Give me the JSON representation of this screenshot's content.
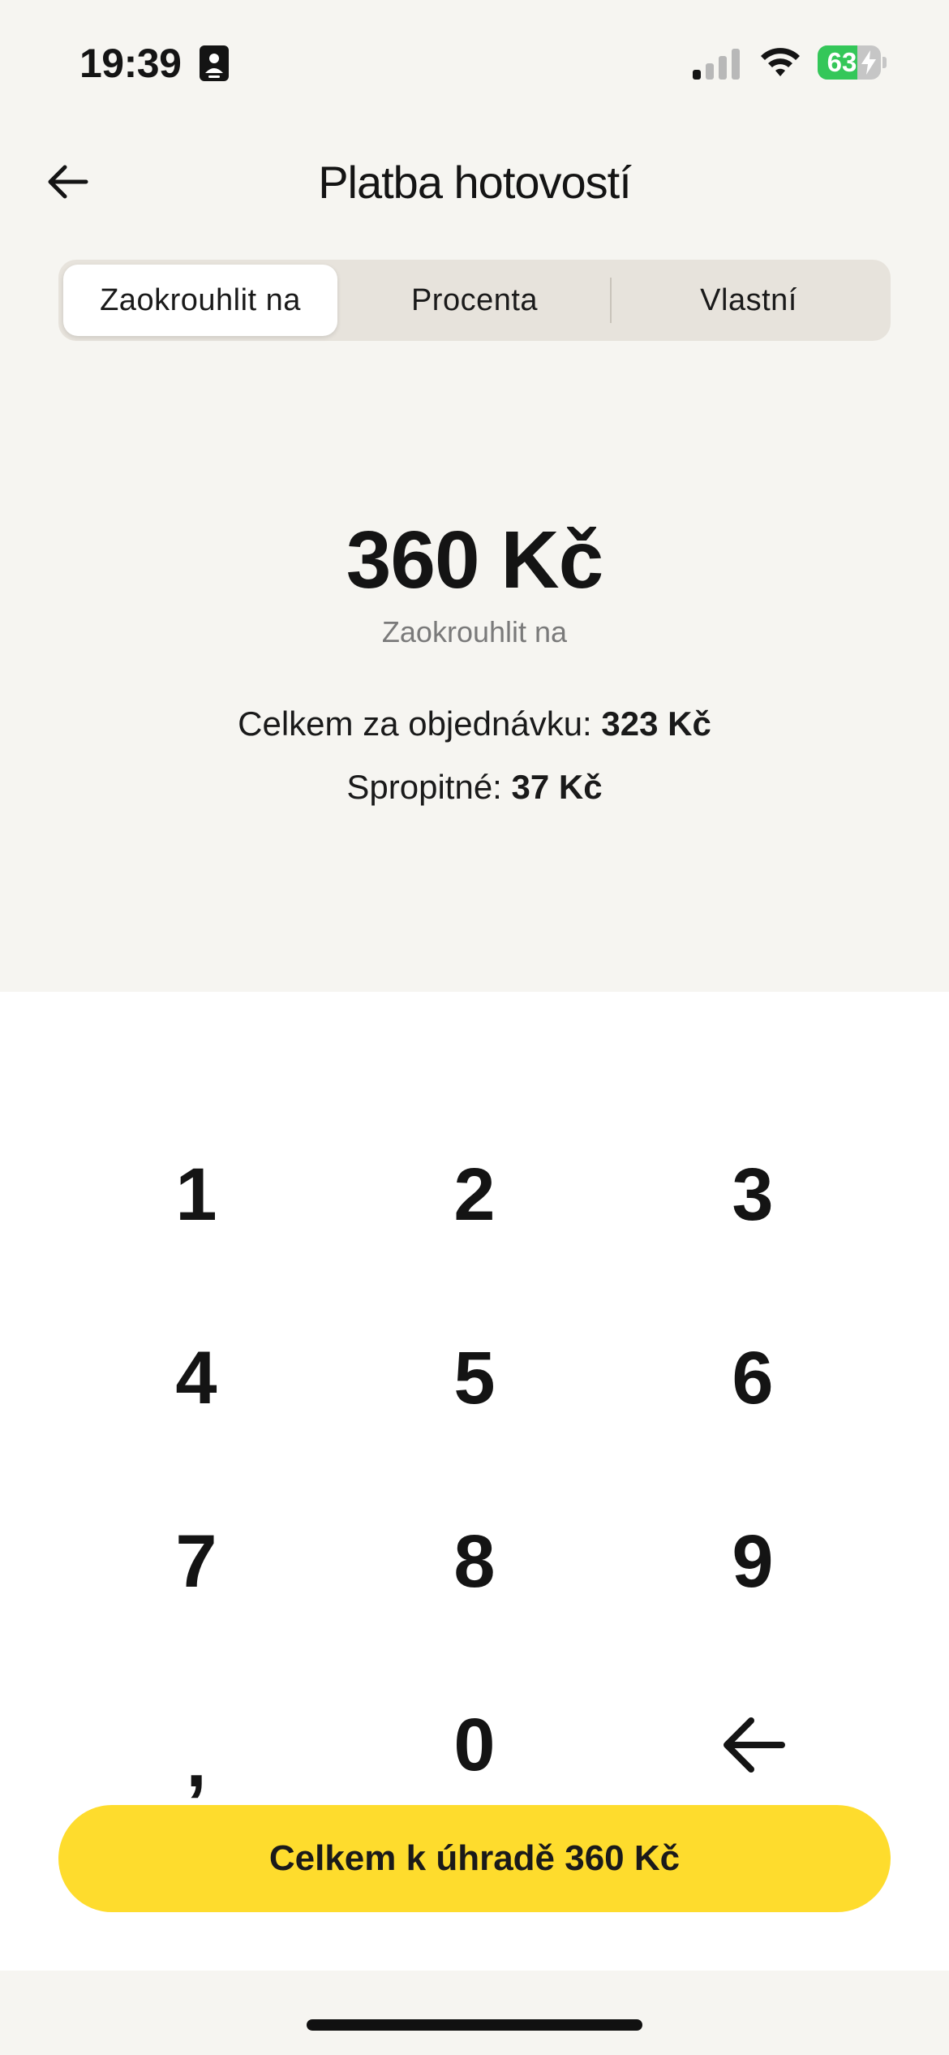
{
  "status_bar": {
    "time": "19:39",
    "battery_percent": "63",
    "battery_level": 0.63,
    "icons": [
      "contact-card-icon",
      "cellular-signal-icon",
      "wifi-icon",
      "battery-charging-icon"
    ]
  },
  "header": {
    "title": "Platba hotovostí",
    "back_icon": "arrow-left-icon"
  },
  "tabs": [
    {
      "label": "Zaokrouhlit na",
      "active": true
    },
    {
      "label": "Procenta",
      "active": false
    },
    {
      "label": "Vlastní",
      "active": false
    }
  ],
  "amount": {
    "value": "360 Kč",
    "caption": "Zaokrouhlit na"
  },
  "summary": {
    "order_label": "Celkem za objednávku:",
    "order_value": "323 Kč",
    "tip_label": "Spropitné:",
    "tip_value": "37 Kč"
  },
  "keypad": {
    "keys": [
      "1",
      "2",
      "3",
      "4",
      "5",
      "6",
      "7",
      "8",
      "9",
      ",",
      "0"
    ],
    "backspace_icon": "backspace-arrow-icon"
  },
  "pay_button": {
    "label": "Celkem k úhradě  360 Kč"
  },
  "colors": {
    "background": "#f6f5f1",
    "keypad_background": "#ffffff",
    "segment_background": "#e7e3dc",
    "accent_yellow": "#fedc2d",
    "battery_green": "#34c759",
    "caption_gray": "#7a7a7a"
  }
}
